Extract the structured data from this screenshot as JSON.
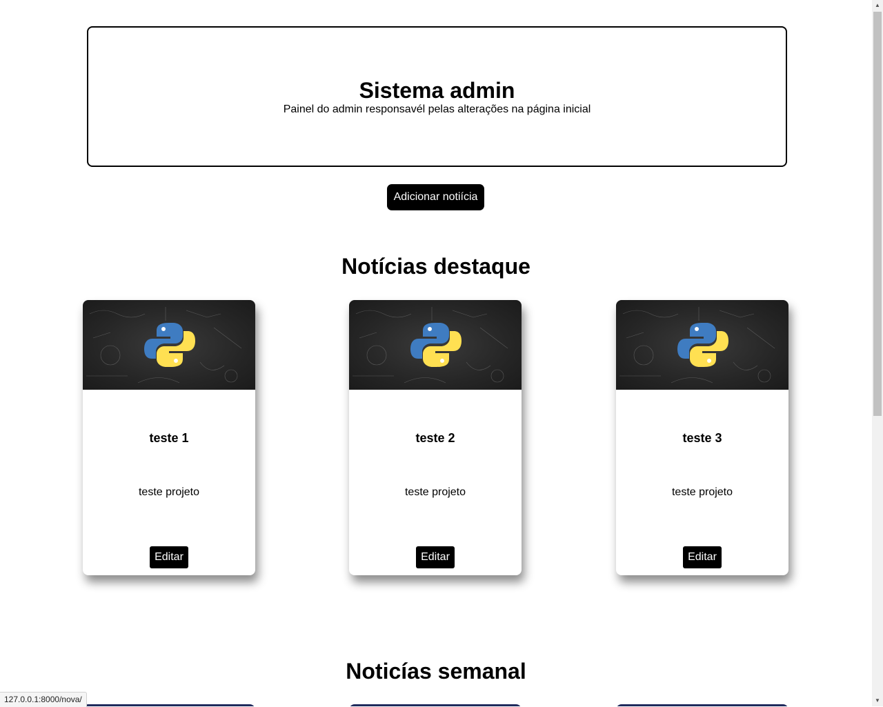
{
  "header": {
    "title": "Sistema admin",
    "subtitle": "Painel do admin responsavél pelas alterações na página inicial"
  },
  "actions": {
    "add_news_label": "Adicionar notiícia"
  },
  "sections": {
    "featured_title": "Notícias destaque",
    "weekly_title": "Noticías semanal"
  },
  "featured_cards": [
    {
      "title": "teste 1",
      "description": "teste projeto",
      "edit_label": "Editar",
      "image_icon": "python-logo-icon"
    },
    {
      "title": "teste 2",
      "description": "teste projeto",
      "edit_label": "Editar",
      "image_icon": "python-logo-icon"
    },
    {
      "title": "teste 3",
      "description": "teste projeto",
      "edit_label": "Editar",
      "image_icon": "python-logo-icon"
    }
  ],
  "status_bar": {
    "url": "127.0.0.1:8000/nova/"
  },
  "colors": {
    "button_bg": "#000000",
    "button_text": "#ffffff",
    "weekly_card_top": "#1f2a5c",
    "python_blue": "#3f7cc1",
    "python_yellow": "#ffe052"
  }
}
